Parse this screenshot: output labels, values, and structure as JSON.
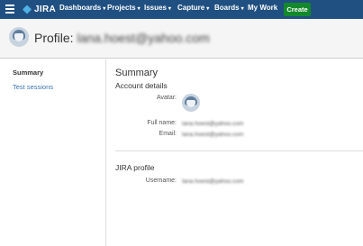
{
  "nav": {
    "logo_text": "JIRA",
    "items": [
      {
        "label": "Dashboards"
      },
      {
        "label": "Projects"
      },
      {
        "label": "Issues"
      },
      {
        "label": "Capture"
      },
      {
        "label": "Boards"
      },
      {
        "label": "My Work"
      }
    ],
    "create_label": "Create",
    "caret": "▾"
  },
  "header": {
    "title_prefix": "Profile:",
    "title_user": "lana.hoest@yahoo.com"
  },
  "sidebar": {
    "items": [
      {
        "label": "Summary"
      },
      {
        "label": "Test sessions"
      }
    ]
  },
  "main": {
    "title": "Summary",
    "account_heading": "Account details",
    "avatar_label": "Avatar:",
    "fullname_label": "Full name:",
    "fullname_value": "lana.hoest@yahoo.com",
    "email_label": "Email:",
    "email_value": "lana.hoest@yahoo.com",
    "jira_heading": "JIRA profile",
    "username_label": "Username:",
    "username_value": "lana.hoest@yahoo.com"
  },
  "colors": {
    "nav_bg": "#205081",
    "create_bg": "#14892c",
    "link": "#3b73af"
  }
}
